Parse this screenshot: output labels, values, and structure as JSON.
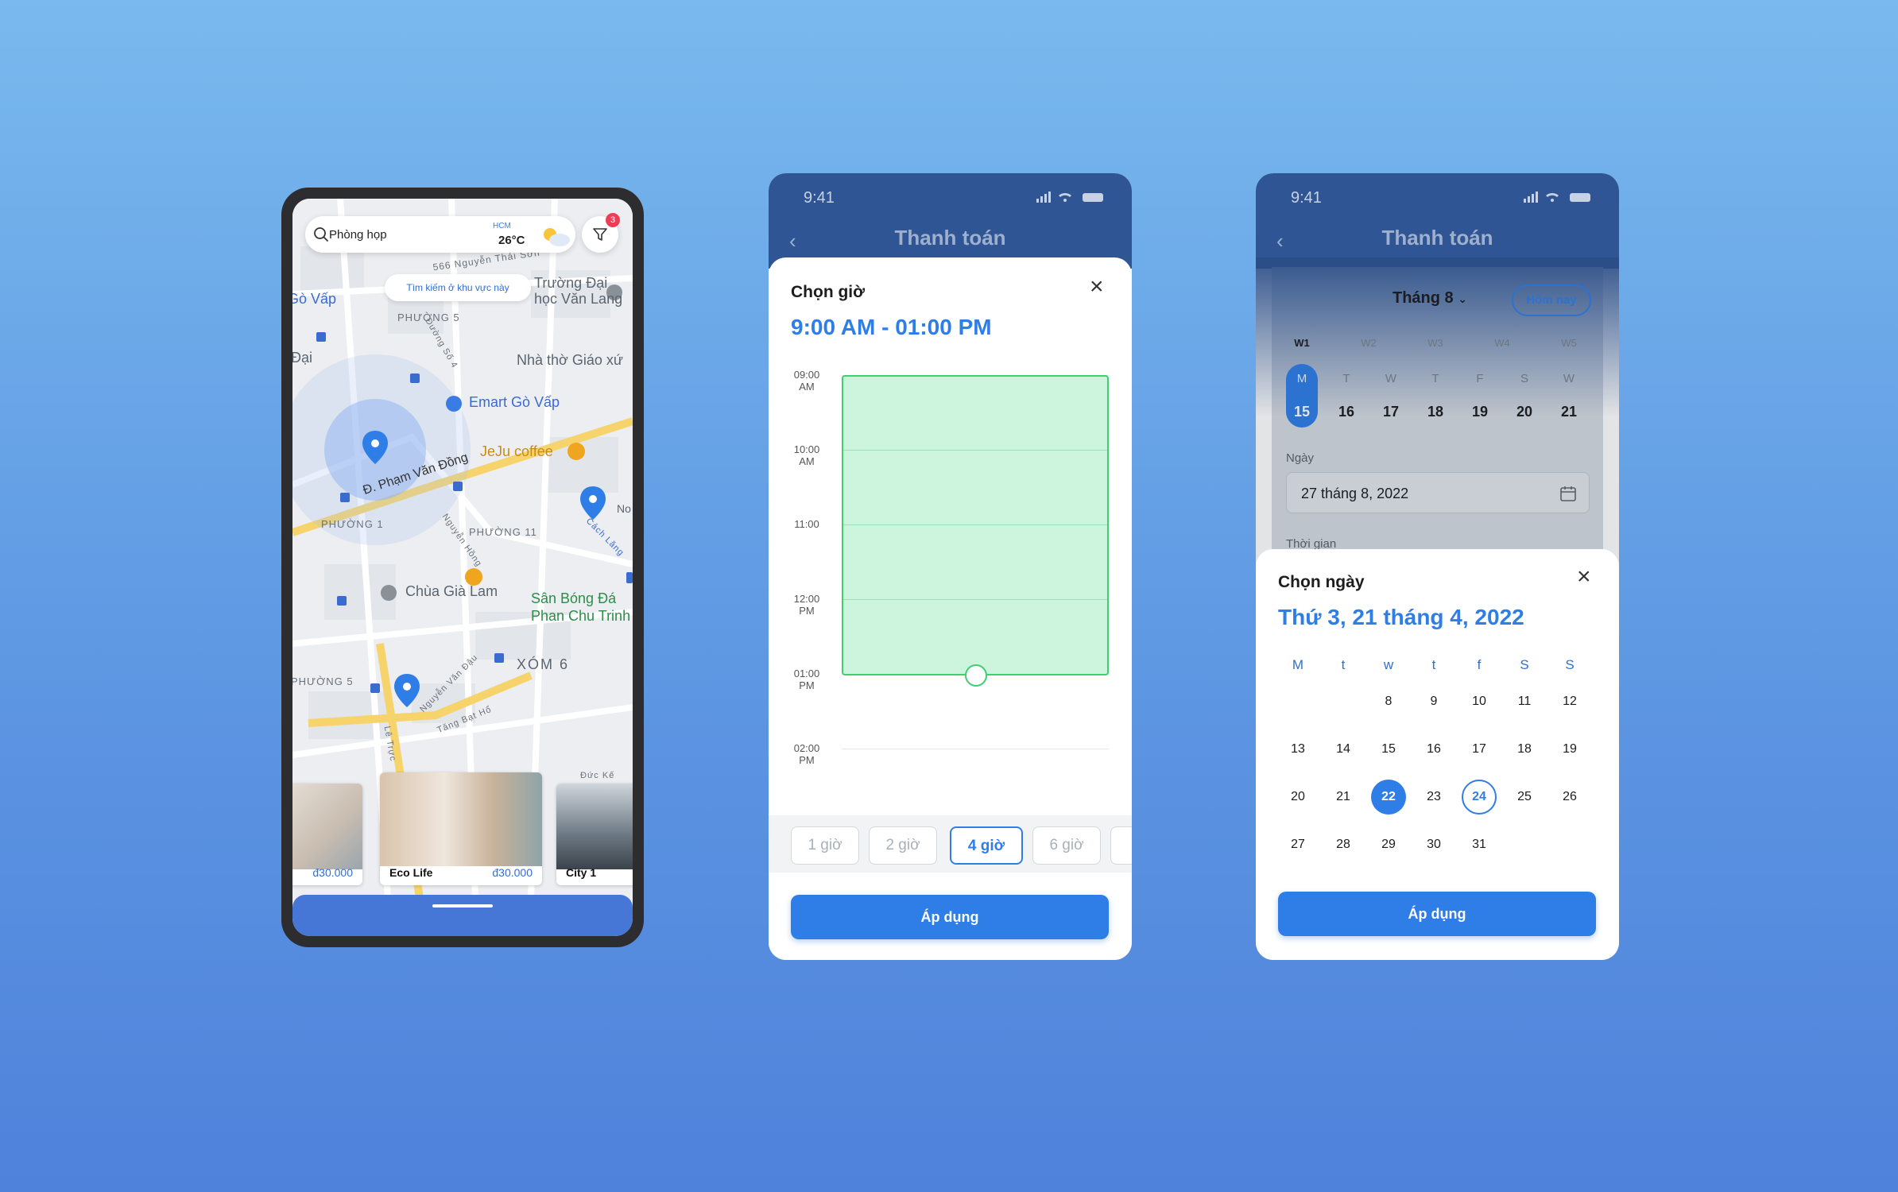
{
  "map_screen": {
    "search_query": "Phòng họp",
    "city": "HCM",
    "temperature": "26°C",
    "filter_badge": "3",
    "search_area_button": "Tìm kiếm ở khu vực này",
    "map_labels": [
      "566 Nguyễn Thái Sơn",
      "Trường Đại học Văn Lang",
      "Gò Vấp",
      "PHƯỜNG 5",
      "Đường Số 4",
      "Nhà thờ Giáo xứ",
      "Đại",
      "Emart Gò Vấp",
      "Đ. Phạm Văn Đồng",
      "JeJu coffee",
      "PHƯỜNG 1",
      "PHƯỜNG 11",
      "Nguyễn Hồng",
      "Chùa Già Lam",
      "Sân Bóng Đá Phan Chu Trinh",
      "XÓM 6",
      "Nguyễn Văn Đậu",
      "Tăng Bạt Hổ",
      "Lê Trực",
      "Đức Kế",
      "PHƯỜNG 5",
      "No",
      "Cách Lăng"
    ],
    "cards": [
      {
        "name": "",
        "price": "đ30.000"
      },
      {
        "name": "Eco Life",
        "price": "đ30.000"
      },
      {
        "name": "City 1",
        "price": ""
      }
    ]
  },
  "time_screen": {
    "status_time": "9:41",
    "header_title": "Thanh toán",
    "sheet_title": "Chọn giờ",
    "selected_range": "9:00 AM - 01:00 PM",
    "hours": [
      {
        "l1": "09:00",
        "l2": "AM"
      },
      {
        "l1": "10:00",
        "l2": "AM"
      },
      {
        "l1": "11:00",
        "l2": ""
      },
      {
        "l1": "12:00",
        "l2": "PM"
      },
      {
        "l1": "01:00",
        "l2": "PM"
      },
      {
        "l1": "02:00",
        "l2": "PM"
      }
    ],
    "durations": [
      "1 giờ",
      "2 giờ",
      "4 giờ",
      "6 giờ"
    ],
    "selected_duration": "4 giờ",
    "apply_label": "Áp dụng"
  },
  "date_screen": {
    "status_time": "9:41",
    "header_title": "Thanh toán",
    "month_label": "Tháng 8",
    "today_button": "Hôm nay",
    "weeks": [
      "W1",
      "W2",
      "W3",
      "W4",
      "W5"
    ],
    "week_days": [
      "M",
      "T",
      "W",
      "T",
      "F",
      "S",
      "W"
    ],
    "week_dates": [
      "15",
      "16",
      "17",
      "18",
      "19",
      "20",
      "21"
    ],
    "day_label": "Ngày",
    "day_value": "27 tháng 8, 2022",
    "time_label": "Thời gian",
    "sheet_title": "Chọn ngày",
    "selected_date": "Thứ 3, 21 tháng 4, 2022",
    "calendar_headers": [
      "M",
      "t",
      "w",
      "t",
      "f",
      "S",
      "S"
    ],
    "calendar_rows": [
      [
        "",
        "",
        "8",
        "9",
        "10",
        "11",
        "12"
      ],
      [
        "13",
        "14",
        "15",
        "16",
        "17",
        "18",
        "19"
      ],
      [
        "20",
        "21",
        "22",
        "23",
        "24",
        "25",
        "26"
      ],
      [
        "27",
        "28",
        "29",
        "30",
        "31",
        "",
        ""
      ]
    ],
    "selected_day": "22",
    "today_day": "24",
    "apply_label": "Áp dụng"
  },
  "colors": {
    "accent": "#2f7ee8",
    "header": "#2f5595",
    "range_fill": "#cdf5dd",
    "range_border": "#3fcf71",
    "badge": "#ef3d56"
  }
}
